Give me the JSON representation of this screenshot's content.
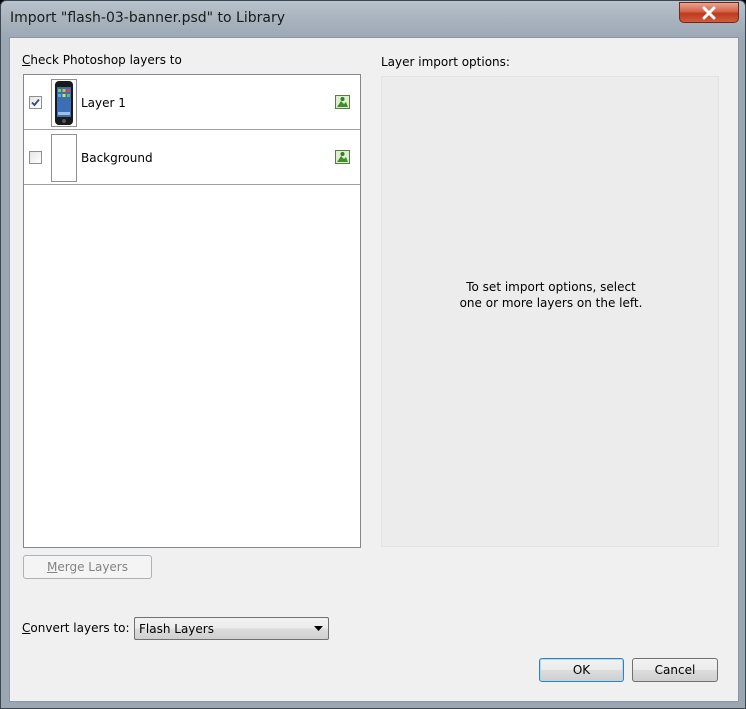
{
  "window": {
    "title": "Import \"flash-03-banner.psd\" to Library",
    "close_icon": "close-icon"
  },
  "layers": {
    "heading": "Check Photoshop layers to",
    "items": [
      {
        "name": "Layer 1",
        "checked": true,
        "thumbnail": "phone-thumbnail",
        "type_icon": "bitmap-image-icon"
      },
      {
        "name": "Background",
        "checked": false,
        "thumbnail": "blank-thumbnail",
        "type_icon": "bitmap-image-icon"
      }
    ],
    "merge_button": "Merge Layers"
  },
  "options": {
    "heading": "Layer import options:",
    "message_line1": "To set import options, select",
    "message_line2": "one or more layers on the left."
  },
  "convert": {
    "label": "Convert layers to:",
    "value": "Flash Layers"
  },
  "buttons": {
    "ok": "OK",
    "cancel": "Cancel"
  },
  "colors": {
    "close_button": "#c0391c",
    "default_button_border": "#3c7fb1"
  }
}
